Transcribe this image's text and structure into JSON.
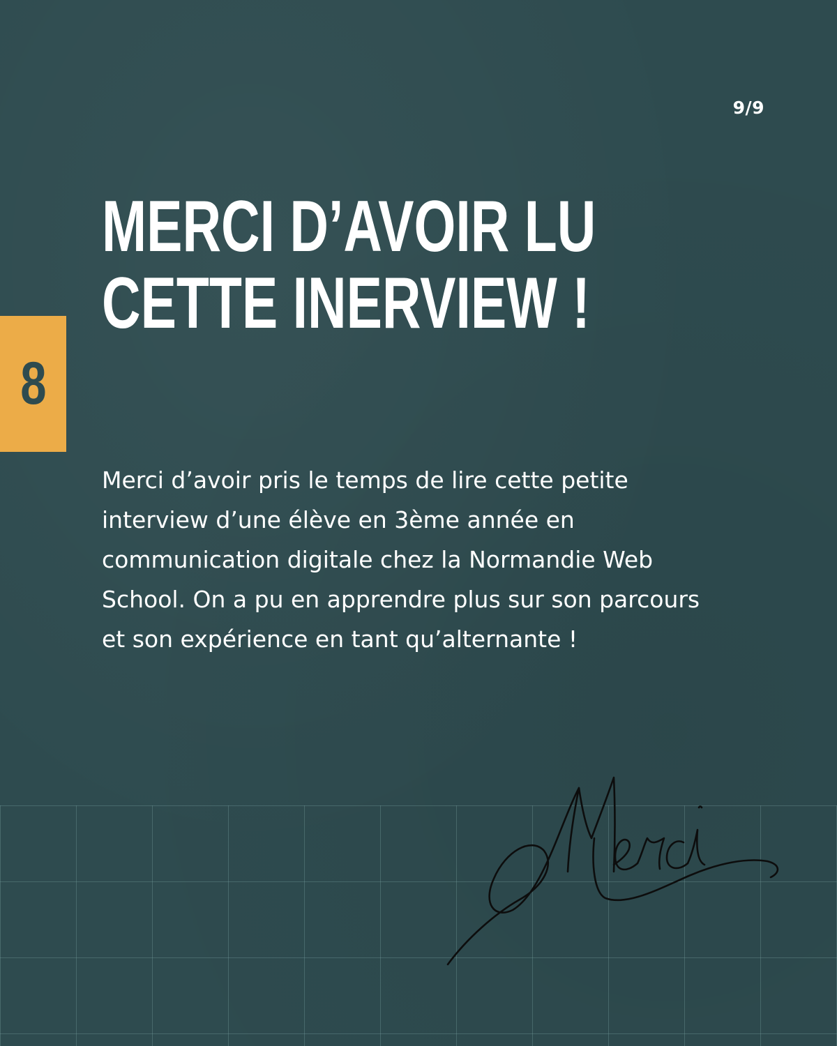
{
  "page_counter": "9/9",
  "badge": {
    "number": "8",
    "color": "#ecac48"
  },
  "headline": {
    "line1": "MERCI D’AVOIR LU",
    "line2": "CETTE INERVIEW !"
  },
  "body": "Merci d’avoir pris le temps de lire cette petite interview d’une élève en 3ème année en communication digitale chez la Normandie Web School. On a pu en apprendre plus sur son parcours et son expérience en tant qu’alternante !",
  "signature_text": "Merci",
  "colors": {
    "background": "#2e4b4f",
    "accent": "#ecac48",
    "text": "#ffffff",
    "signature": "#0d0d0d"
  }
}
